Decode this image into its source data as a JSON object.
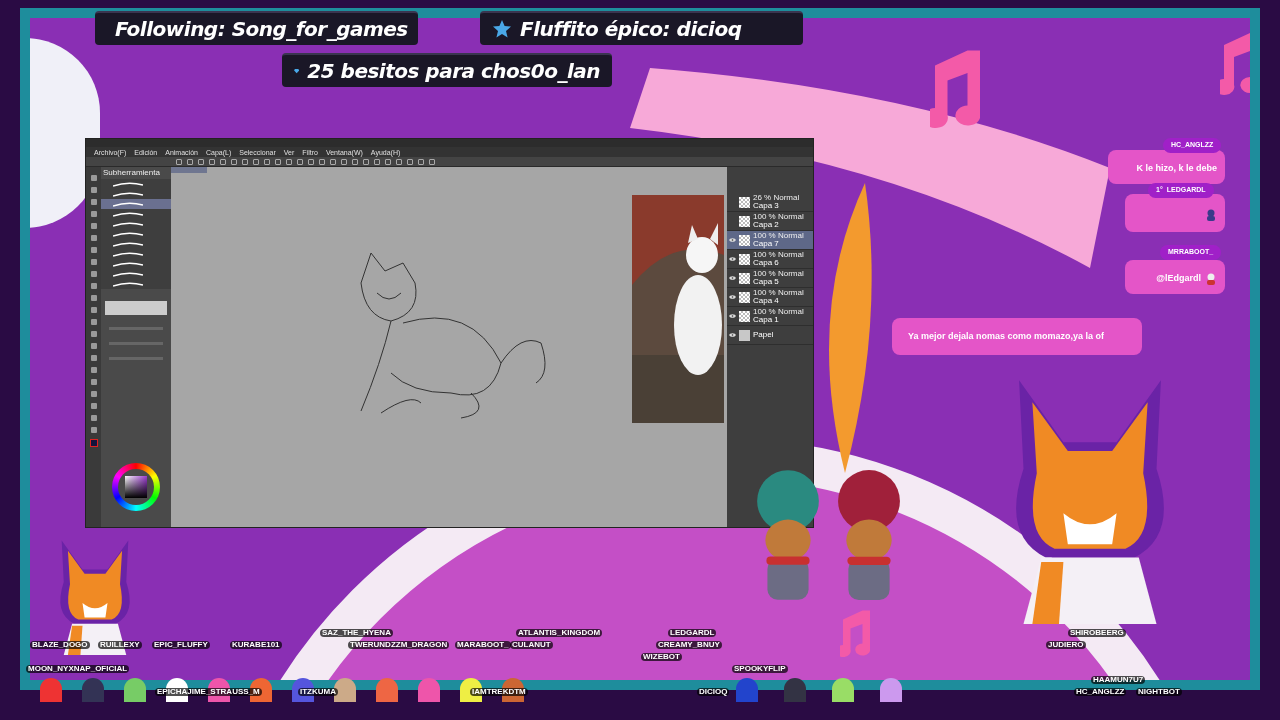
{
  "alerts": [
    {
      "kind": "follow",
      "text": "Following: Song_for_games"
    },
    {
      "kind": "star",
      "text": "Fluffito épico: dicioq"
    },
    {
      "kind": "gem",
      "text": "25 besitos para chos0o_lan"
    }
  ],
  "app": {
    "menu": [
      "Archivo(F)",
      "Edición",
      "Animación",
      "Capa(L)",
      "Seleccionar",
      "Ver",
      "Filtro",
      "Ventana(W)",
      "Ayuda(H)"
    ],
    "tool_panel_title": "Subherramienta",
    "brushes": [
      {
        "selected": false
      },
      {
        "selected": false
      },
      {
        "selected": true
      },
      {
        "selected": false
      },
      {
        "selected": false
      },
      {
        "selected": false
      },
      {
        "selected": false
      },
      {
        "selected": false
      },
      {
        "selected": false
      },
      {
        "selected": false
      },
      {
        "selected": false
      }
    ],
    "layers": [
      {
        "mode": "26 % Normal",
        "name": "Capa 3",
        "visible": false,
        "selected": false
      },
      {
        "mode": "100 % Normal",
        "name": "Capa 2",
        "visible": false,
        "selected": false
      },
      {
        "mode": "100 % Normal",
        "name": "Capa 7",
        "visible": true,
        "selected": true
      },
      {
        "mode": "100 % Normal",
        "name": "Capa 6",
        "visible": true,
        "selected": false
      },
      {
        "mode": "100 % Normal",
        "name": "Capa 5",
        "visible": true,
        "selected": false
      },
      {
        "mode": "100 % Normal",
        "name": "Capa 4",
        "visible": true,
        "selected": false
      },
      {
        "mode": "100 % Normal",
        "name": "Capa 1",
        "visible": true,
        "selected": false
      },
      {
        "name": "Papel",
        "visible": true,
        "selected": false
      }
    ]
  },
  "chat": [
    {
      "user": "HC_ANGLZZ",
      "kind": "text",
      "message": "K le hizo, k le debe"
    },
    {
      "user": "LEDGARDL",
      "kind": "emote",
      "badge": "1°"
    },
    {
      "user": "MRRABOOT_",
      "kind": "text",
      "message": "@lEdgardl"
    }
  ],
  "chat_banner": "Ya mejor dejala nomas como momazo,ya la of",
  "viewers": [
    "BLAZE_DOGO",
    "RUILLEXY",
    "EPIC_FLUFFY",
    "KURABE101",
    "SAZ_THE_HYENA",
    "TWERUNDZZM_DRAGON",
    "MARABOOT_",
    "CULANUT",
    "ATLANTIS_KINGDOM",
    "MOON_NYXNAP_OFICIAL",
    "EPICHAJIME_STRAUSS_M",
    "ITZKUMA",
    "IAMTREKDTM",
    "LEDGARDL",
    "CREAMY_BNUY",
    "WIZEBOT",
    "DICIOQ",
    "SPOOKYFLIP",
    "SHIROBEERG",
    "JUDIERO",
    "HAAMUN7U7",
    "HC_ANGLZZ",
    "NIGHTBOT"
  ]
}
